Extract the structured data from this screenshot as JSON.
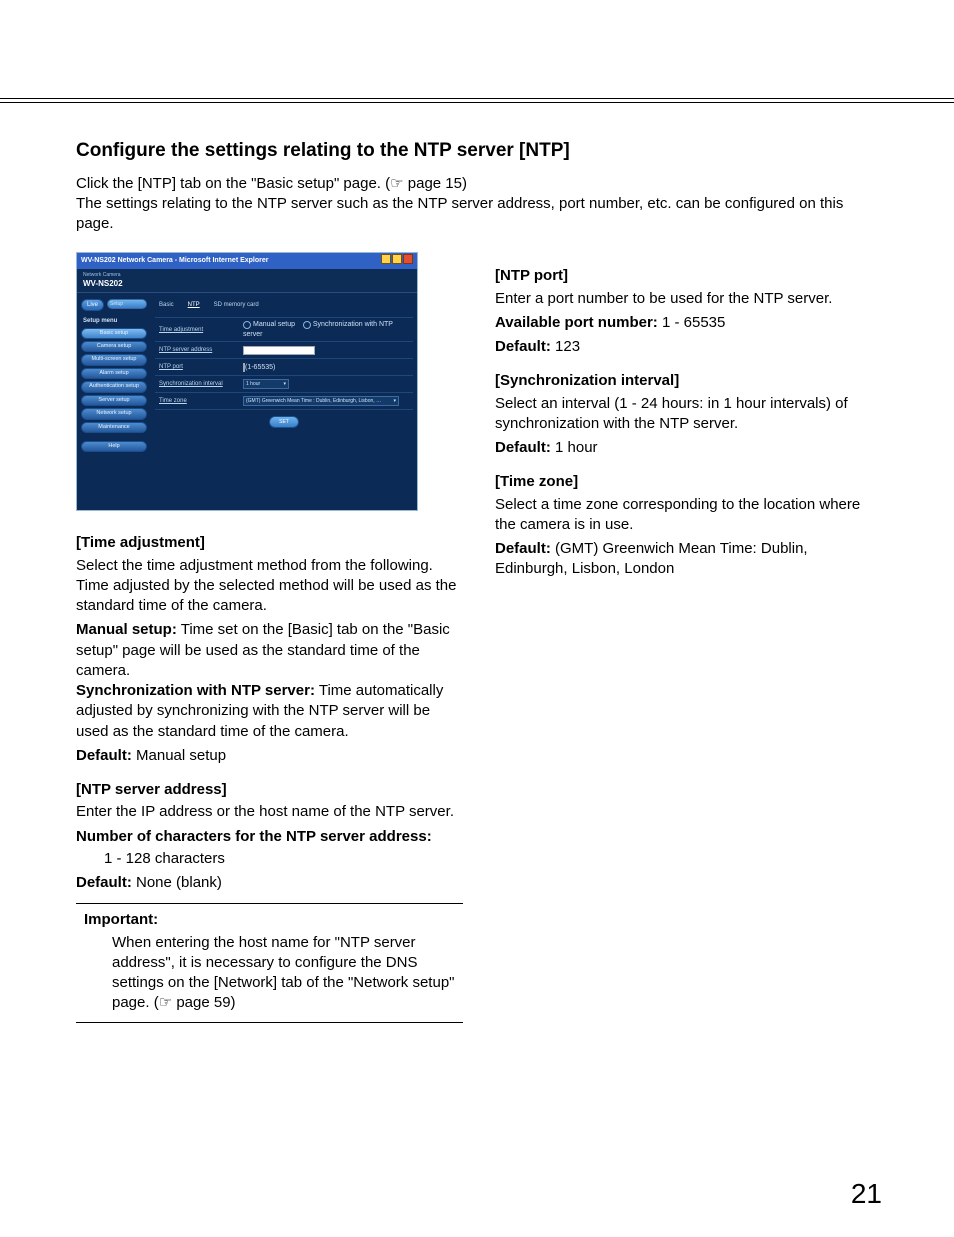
{
  "page_number": "21",
  "title": "Configure the settings relating to the NTP server [NTP]",
  "intro_1": "Click the [NTP] tab on the \"Basic setup\" page. (",
  "intro_ref": "☞ page 15",
  "intro_2": ")",
  "intro_3": "The settings relating to the NTP server such as the NTP server address, port number, etc. can be configured on this page.",
  "shot": {
    "window_title": "WV-NS202 Network Camera - Microsoft Internet Explorer",
    "model_small": "Network Camera",
    "model": "WV-NS202",
    "top_tabs": {
      "live": "Live",
      "setup": "Setup"
    },
    "menu_header": "Setup menu",
    "menu": [
      "Basic setup",
      "Camera setup",
      "Multi-screen setup",
      "Alarm setup",
      "Authentication setup",
      "Server setup",
      "Network setup",
      "Maintenance"
    ],
    "help": "Help",
    "page_tabs": [
      "Basic",
      "NTP",
      "SD memory card"
    ],
    "rows": {
      "time_adj": "Time adjustment",
      "ntp_addr": "NTP server address",
      "ntp_port": "NTP port",
      "sync_int": "Synchronization interval",
      "tz": "Time zone"
    },
    "radio_manual": "Manual setup",
    "radio_ntp": "Synchronization with NTP server",
    "port_hint": "(1-65535)",
    "interval_value": "1 hour",
    "tz_value": "(GMT) Greenwich Mean Time : Dublin, Edinburgh, Lisbon, London",
    "set_btn": "SET"
  },
  "left": {
    "h_timeadj": "[Time adjustment]",
    "timeadj_p": "Select the time adjustment method from the following. Time adjusted by the selected method will be used as the standard time of the camera.",
    "manual_b": "Manual setup:",
    "manual_t": " Time set on the [Basic] tab on the \"Basic setup\" page will be used as the standard time of the camera.",
    "sync_b": "Synchronization with NTP server:",
    "sync_t": " Time automatically adjusted by synchronizing with the NTP server will be used as the standard time of the camera.",
    "def_b": "Default:",
    "def_t": " Manual setup",
    "h_addr": "[NTP server address]",
    "addr_p": "Enter the IP address or the host name of the NTP server.",
    "addr_num_b": "Number of characters for the NTP server address:",
    "addr_num_t": "1 - 128 characters",
    "addr_def_b": "Default:",
    "addr_def_t": " None (blank)",
    "imp_h": "Important:",
    "imp_p1": "When entering the host name for \"NTP server address\", it is necessary to configure the DNS settings on the [Network] tab of the \"Network setup\" page. (",
    "imp_ref": "☞ page 59",
    "imp_p2": ")"
  },
  "right": {
    "h_port": "[NTP port]",
    "port_p": "Enter a port number to be used for the NTP server.",
    "port_av_b": "Available port number:",
    "port_av_t": " 1 - 65535",
    "port_def_b": "Default:",
    "port_def_t": " 123",
    "h_sync": "[Synchronization interval]",
    "sync_p": "Select an interval (1 - 24 hours: in 1 hour intervals) of synchronization with the NTP server.",
    "sync_def_b": "Default:",
    "sync_def_t": " 1 hour",
    "h_tz": "[Time zone]",
    "tz_p": "Select a time zone corresponding to the location where the camera is in use.",
    "tz_def_b": "Default:",
    "tz_def_t": " (GMT) Greenwich Mean Time: Dublin, Edinburgh, Lisbon, London"
  }
}
